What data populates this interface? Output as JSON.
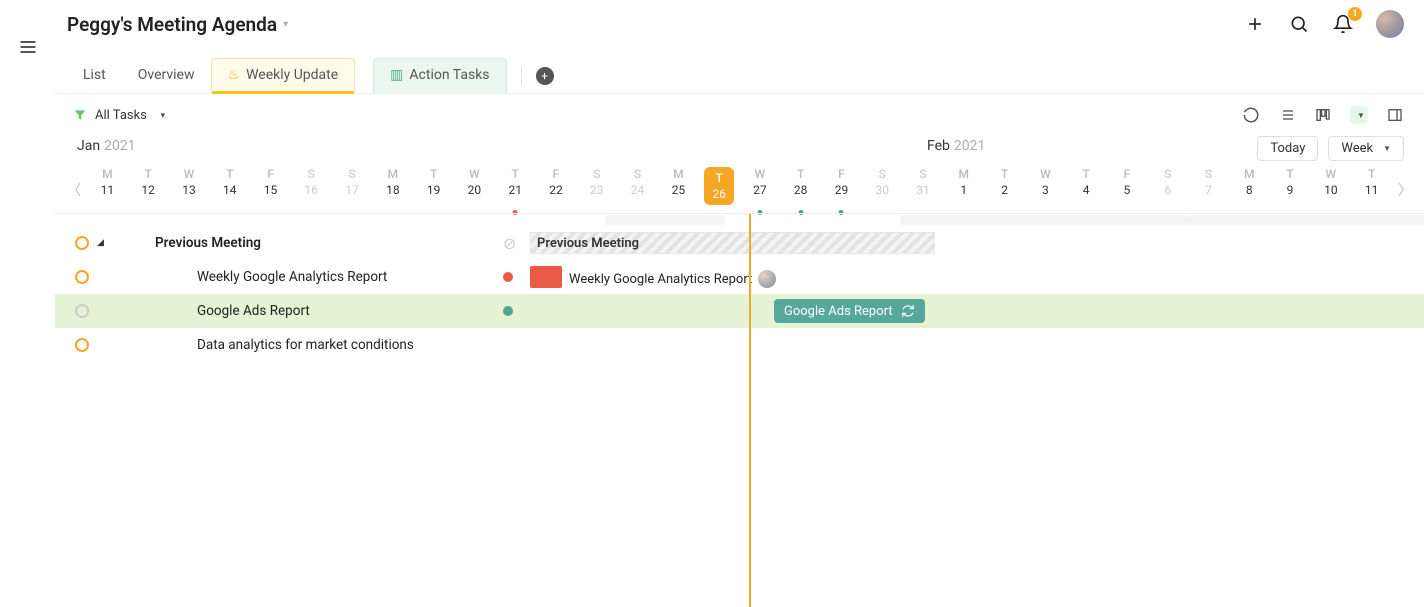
{
  "header": {
    "title": "Peggy's Meeting Agenda",
    "notification_count": "1"
  },
  "tabs": {
    "list": "List",
    "overview": "Overview",
    "weekly": "Weekly Update",
    "action": "Action Tasks"
  },
  "filter": {
    "label": "All Tasks"
  },
  "months": {
    "jan": {
      "m": "Jan",
      "y": "2021"
    },
    "feb": {
      "m": "Feb",
      "y": "2021"
    }
  },
  "controls": {
    "today": "Today",
    "range": "Week"
  },
  "days": [
    {
      "dow": "M",
      "num": "11"
    },
    {
      "dow": "T",
      "num": "12"
    },
    {
      "dow": "W",
      "num": "13"
    },
    {
      "dow": "T",
      "num": "14"
    },
    {
      "dow": "F",
      "num": "15"
    },
    {
      "dow": "S",
      "num": "16",
      "wk": true
    },
    {
      "dow": "S",
      "num": "17",
      "wk": true
    },
    {
      "dow": "M",
      "num": "18"
    },
    {
      "dow": "T",
      "num": "19"
    },
    {
      "dow": "W",
      "num": "20"
    },
    {
      "dow": "T",
      "num": "21",
      "dot": "red"
    },
    {
      "dow": "F",
      "num": "22"
    },
    {
      "dow": "S",
      "num": "23",
      "wk": true
    },
    {
      "dow": "S",
      "num": "24",
      "wk": true
    },
    {
      "dow": "M",
      "num": "25"
    },
    {
      "dow": "T",
      "num": "26",
      "today": true
    },
    {
      "dow": "W",
      "num": "27",
      "dot": "teal"
    },
    {
      "dow": "T",
      "num": "28",
      "dot": "teal"
    },
    {
      "dow": "F",
      "num": "29",
      "dot": "teal"
    },
    {
      "dow": "S",
      "num": "30",
      "wk": true
    },
    {
      "dow": "S",
      "num": "31",
      "wk": true
    },
    {
      "dow": "M",
      "num": "1"
    },
    {
      "dow": "T",
      "num": "2"
    },
    {
      "dow": "W",
      "num": "3"
    },
    {
      "dow": "T",
      "num": "4"
    },
    {
      "dow": "F",
      "num": "5"
    },
    {
      "dow": "S",
      "num": "6",
      "wk": true
    },
    {
      "dow": "S",
      "num": "7",
      "wk": true
    },
    {
      "dow": "M",
      "num": "8"
    },
    {
      "dow": "T",
      "num": "9"
    },
    {
      "dow": "W",
      "num": "10"
    },
    {
      "dow": "T",
      "num": "11"
    }
  ],
  "tasks": {
    "prev_meeting": "Previous Meeting",
    "weekly_ga": "Weekly Google Analytics Report",
    "google_ads": "Google Ads Report",
    "market": "Data analytics for market conditions"
  },
  "bars": {
    "prev_meeting": "Previous Meeting",
    "weekly_ga": "Weekly Google Analytics Report",
    "google_ads": "Google Ads Report"
  }
}
